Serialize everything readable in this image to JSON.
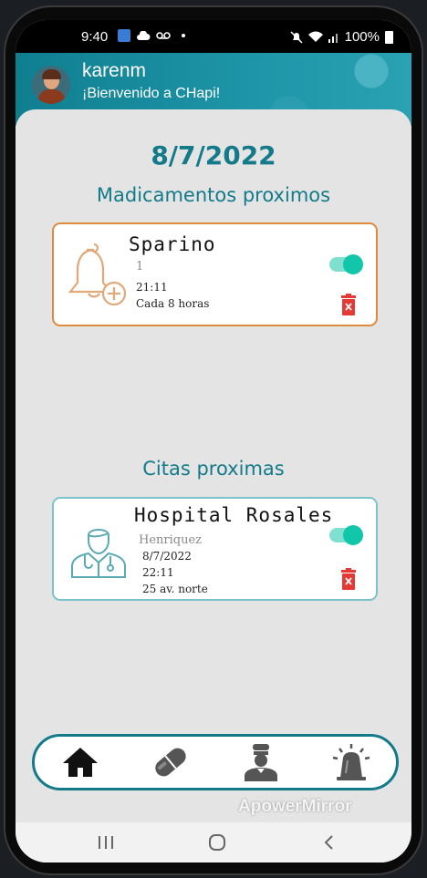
{
  "status_bar": {
    "time": "9:40",
    "battery": "100%"
  },
  "header": {
    "username": "karenm",
    "welcome": "¡Bienvenido a CHapi!"
  },
  "main": {
    "date": "8/7/2022",
    "medications_title": "Madicamentos proximos",
    "appointments_title": "Citas proximas"
  },
  "medication_card": {
    "name": "Sparino",
    "dose": "1",
    "time": "21:11",
    "frequency": "Cada 8 horas",
    "enabled": true,
    "icon": "bell-plus-icon"
  },
  "appointment_card": {
    "place": "Hospital Rosales",
    "doctor": "Henriquez",
    "date": "8/7/2022",
    "time": "22:11",
    "address": "25 av. norte",
    "enabled": true,
    "icon": "doctor-icon"
  },
  "bottom_nav": {
    "items": [
      "home-icon",
      "pill-icon",
      "nurse-icon",
      "alarm-siren-icon"
    ]
  },
  "watermark": "ApowerMirror",
  "colors": {
    "accent": "#137a8a",
    "med_border": "#e08a3c",
    "cita_border": "#7cc3c9",
    "toggle_on": "#12c7a9",
    "delete": "#e53935"
  }
}
